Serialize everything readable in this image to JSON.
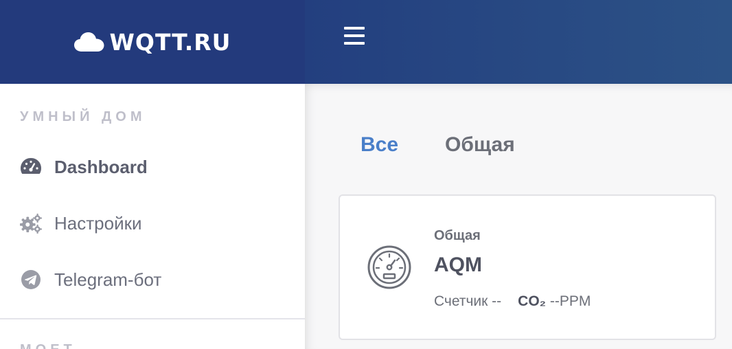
{
  "header": {
    "brand": "WQTT.RU",
    "brand_icon": "cloud-icon",
    "menu_icon": "hamburger-icon",
    "colors": {
      "left": "#233a7c",
      "right": "#2c5286"
    }
  },
  "sidebar": {
    "section_label": "УМНЫЙ ДОМ",
    "items": [
      {
        "label": "Dashboard",
        "icon": "tachometer-icon",
        "active": true
      },
      {
        "label": "Настройки",
        "icon": "cogs-icon",
        "active": false
      },
      {
        "label": "Telegram-бот",
        "icon": "telegram-icon",
        "active": false
      }
    ],
    "next_section_label": "МОЕТ"
  },
  "main": {
    "tabs": [
      {
        "label": "Все",
        "active": true,
        "color": "#4a7fc9"
      },
      {
        "label": "Общая",
        "active": false
      }
    ],
    "card": {
      "icon": "gauge-icon",
      "group": "Общая",
      "title": "AQM",
      "counter": "Счетчик --",
      "co2_label": "CO₂",
      "co2_value": "--PPM"
    }
  }
}
